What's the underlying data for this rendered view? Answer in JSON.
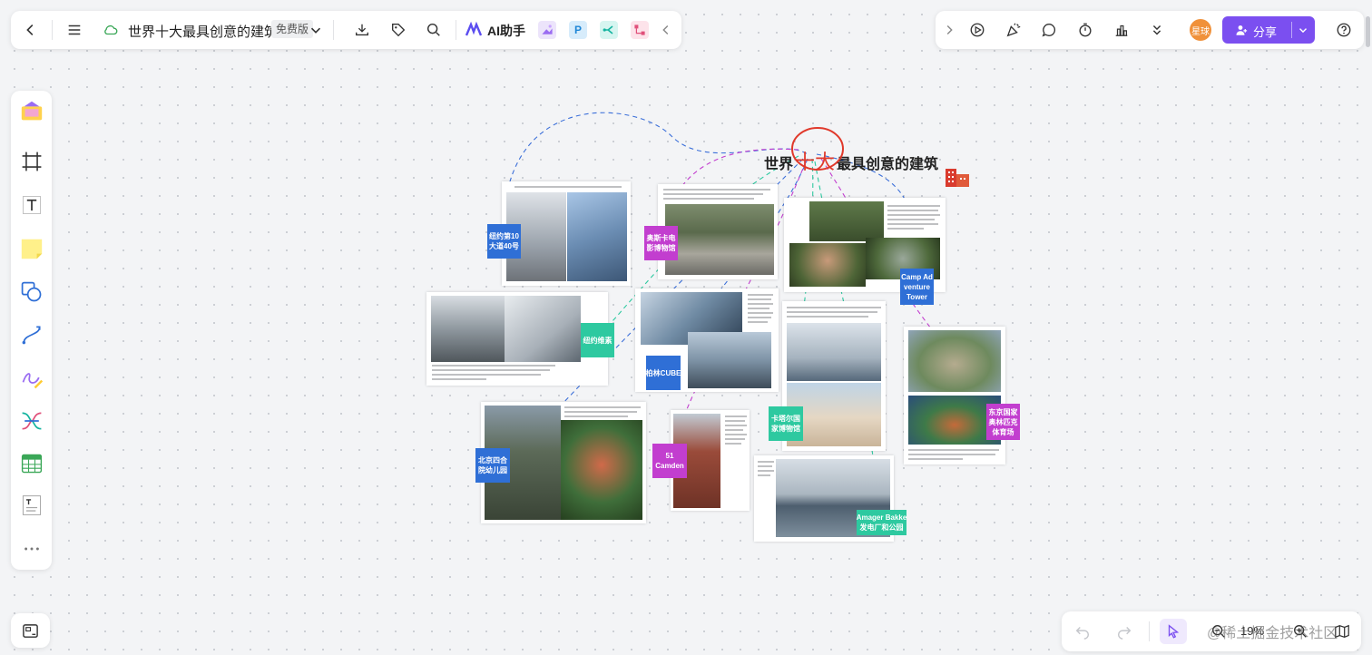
{
  "topbar": {
    "doc_title": "世界十大最具创意的建筑",
    "edition_badge": "免费版",
    "ai_label": "AI助手",
    "plugins": [
      "P"
    ]
  },
  "topright": {
    "avatar_text": "星球",
    "share_label": "分享"
  },
  "bottom": {
    "zoom": "19%"
  },
  "watermark": "@稀土掘金技术社区",
  "board": {
    "title_prefix": "世界",
    "title_highlight": "十大",
    "title_suffix": "最具创意的建筑",
    "tags": [
      "纽约第10\n大道40号",
      "奥斯卡电\n影博物馆",
      "Camp Ad\nventure\nTower",
      "纽约维素",
      "柏林CUBE",
      "卡塔尔国\n家博物馆",
      "东京国家\n奥林匹克\n体育场",
      "北京四合\n院幼儿园",
      "51\nCamden",
      "Amager Bakke\n发电厂和公园"
    ]
  },
  "colors": {
    "accent": "#7b4ff0",
    "tag_blue": "#2f6fd6",
    "tag_purple": "#c23ecf",
    "tag_teal": "#2ec9a0",
    "title_circle": "#e0392b"
  }
}
